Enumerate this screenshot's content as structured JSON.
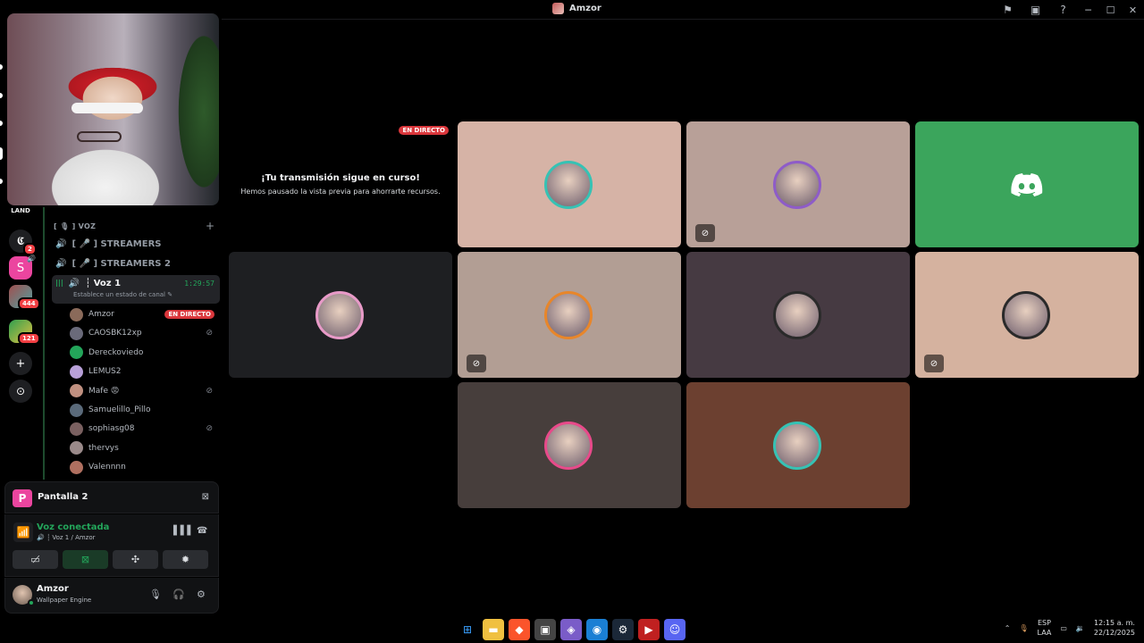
{
  "window": {
    "title": "Amzor"
  },
  "title_actions": {
    "inbox_icon": "flag-icon",
    "overlay_icon": "monitor-icon",
    "help_icon": "help-icon",
    "minimize": "─",
    "maximize": "☐",
    "close": "✕"
  },
  "guilds": {
    "items": [
      {
        "label": "LAND",
        "color": "#000000"
      },
      {
        "icon": "spiral-icon",
        "badge": "2",
        "color": "#1e1f22"
      },
      {
        "label": "S",
        "color": "#eb459f"
      },
      {
        "badge": "444",
        "color": "#3a3c42"
      },
      {
        "badge": "121",
        "color": "#3a3c42"
      },
      {
        "icon": "add-server-icon",
        "label": "+",
        "color": "#1e1f22"
      },
      {
        "icon": "discover-icon",
        "label": "⊙",
        "color": "#1e1f22"
      }
    ]
  },
  "sidebar": {
    "category": "[ 🎙 ] VOZ",
    "channels": [
      {
        "name": "[ 🎤 ] STREAMERS"
      },
      {
        "name": "[ 🎤 ] STREAMERS 2"
      }
    ],
    "active_channel": {
      "name": "┆ Voz 1",
      "timer": "1:29:57",
      "status": "Establece un estado de canal ✎"
    },
    "users": [
      {
        "name": "Amzor",
        "live": "EN DIRECTO",
        "color": "#8a6a5a"
      },
      {
        "name": "CAOSBK12xp",
        "muted": true,
        "color": "#6a6a7a"
      },
      {
        "name": "Dereckoviedo",
        "color": "#23a55a"
      },
      {
        "name": "LEMUS2",
        "color": "#b8a0d8"
      },
      {
        "name": "Mafe 😡",
        "muted": true,
        "color": "#c09080"
      },
      {
        "name": "Samuelillo_Pillo",
        "color": "#5a6a7a"
      },
      {
        "name": "sophiasg08",
        "muted": true,
        "color": "#7a6060"
      },
      {
        "name": "thervys",
        "color": "#9a8a8a"
      },
      {
        "name": "Valennnn",
        "color": "#b07060"
      }
    ]
  },
  "panel": {
    "screen_label": "Pantalla 2",
    "screen_letter": "P",
    "voice_title": "Voz conectada",
    "voice_sub": "🔊 ┆ Voz 1 / Amzor",
    "me_name": "Amzor",
    "me_status": "Wallpaper Engine"
  },
  "stream": {
    "live_tag": "EN DIRECTO",
    "title": "¡Tu transmisión sigue en curso!",
    "subtitle": "Hemos pausado la vista previa para ahorrarte recursos."
  },
  "tiles": [
    {
      "bg": "#d6b3a6",
      "ring": "#36c2b4",
      "muted": false
    },
    {
      "bg": "#b8a098",
      "ring": "#8e5cc8",
      "muted": true
    },
    {
      "bg": "#3ba55c",
      "discord": true,
      "muted": false
    },
    {
      "bg": "#1e1f22",
      "ring": "#e89ac8",
      "muted": false
    },
    {
      "bg": "#b29e94",
      "ring": "#e8862a",
      "muted": true
    },
    {
      "bg": "#463a42",
      "ring": "#2a2a2a",
      "muted": false
    },
    {
      "bg": "#d5b29f",
      "ring": "#2a2a2a",
      "muted": true
    },
    {
      "bg": "#473e3c",
      "ring": "#e84a8a",
      "muted": false
    },
    {
      "bg": "#6c4030",
      "ring": "#36c2b4",
      "muted": false
    }
  ],
  "taskbar": {
    "apps": [
      "windows-start-icon",
      "file-explorer-icon",
      "brave-icon",
      "store-icon",
      "game-icon",
      "edge-icon",
      "steam-icon",
      "video-app-icon",
      "discord-icon"
    ],
    "lang_top": "ESP",
    "lang_bottom": "LAA",
    "time": "12:15 a. m.",
    "date": "22/12/2025"
  }
}
